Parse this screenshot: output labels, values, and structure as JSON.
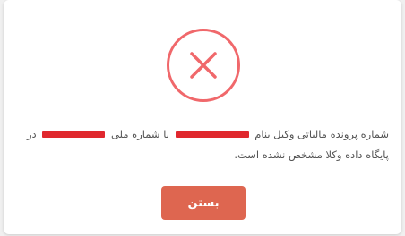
{
  "dialog": {
    "icon": "error-x-circle-icon",
    "icon_color": "#f0686b",
    "message": {
      "part1": "شماره پرونده مالیاتی وکیل بنام",
      "part2": "با شماره ملی",
      "part3": "در پایگاه داده وکلا مشخص نشده است."
    },
    "close_label": "بستن",
    "button_color": "#de6650"
  }
}
